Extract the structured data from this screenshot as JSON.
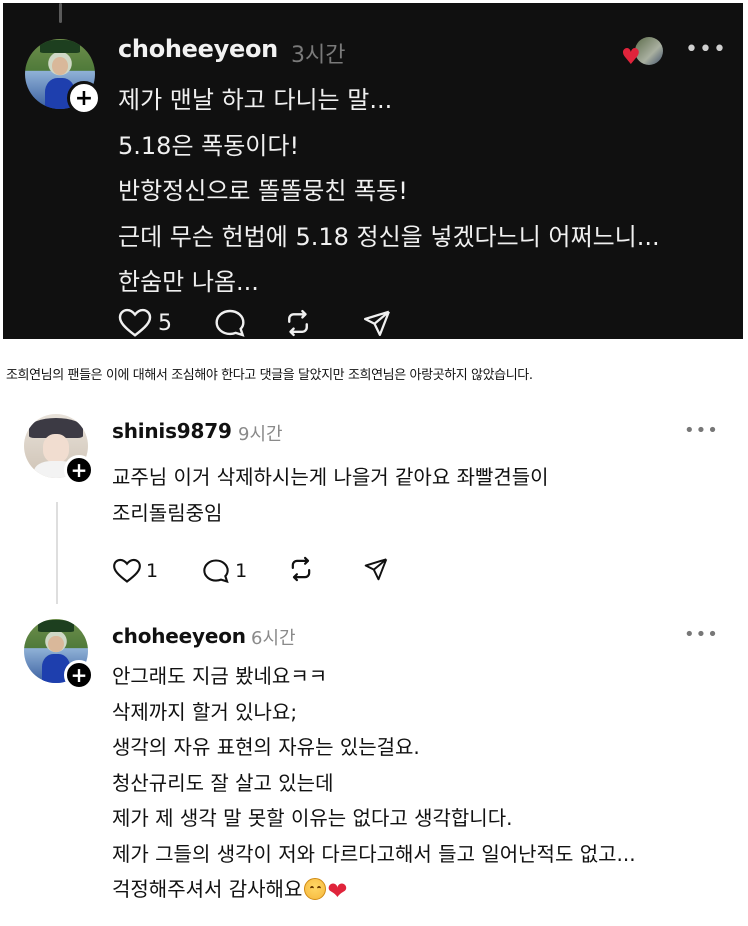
{
  "post": {
    "username": "choheeyeon",
    "time": "3시간",
    "more": "•••",
    "lines": [
      "제가 맨날 하고 다니는 말...",
      "5.18은 폭동이다!",
      "반항정신으로 똘똘뭉친 폭동!",
      "근데 무슨 헌법에 5.18 정신을 넣겠다느니 어쩌느니...",
      "한숨만 나옴..."
    ],
    "like_count": "5",
    "plus": "+",
    "liker_heart": "♥"
  },
  "caption": "조희연님의 팬들은 이에 대해서 조심해야 한다고 댓글을 달았지만 조희연님은 아랑곳하지 않았습니다.",
  "comments": [
    {
      "username": "shinis9879",
      "time": "9시간",
      "more": "•••",
      "lines": [
        "교주님 이거 삭제하시는게 나을거 같아요 좌빨견들이",
        "조리돌림중임"
      ],
      "like_count": "1",
      "reply_count": "1",
      "plus": "+"
    },
    {
      "username": "choheeyeon",
      "time": "6시간",
      "more": "•••",
      "lines": [
        "안그래도 지금 봤네요ㅋㅋ",
        "삭제까지 할거 있나요;",
        "생각의 자유 표현의 자유는 있는걸요.",
        "청산규리도 잘 살고 있는데",
        "제가 제 생각 말 못할 이유는 없다고 생각합니다.",
        "제가 그들의 생각이 저와 다르다고해서 들고 일어난적도 없고...",
        "걱정해주셔서 감사해요"
      ],
      "emoji_heart": "❤",
      "plus": "+"
    }
  ],
  "colors": {
    "dark_bg": "#101010",
    "like_heart": "#e0243b"
  },
  "icons": [
    "heart-icon",
    "comment-icon",
    "repost-icon",
    "send-icon",
    "more-icon",
    "plus-icon"
  ]
}
